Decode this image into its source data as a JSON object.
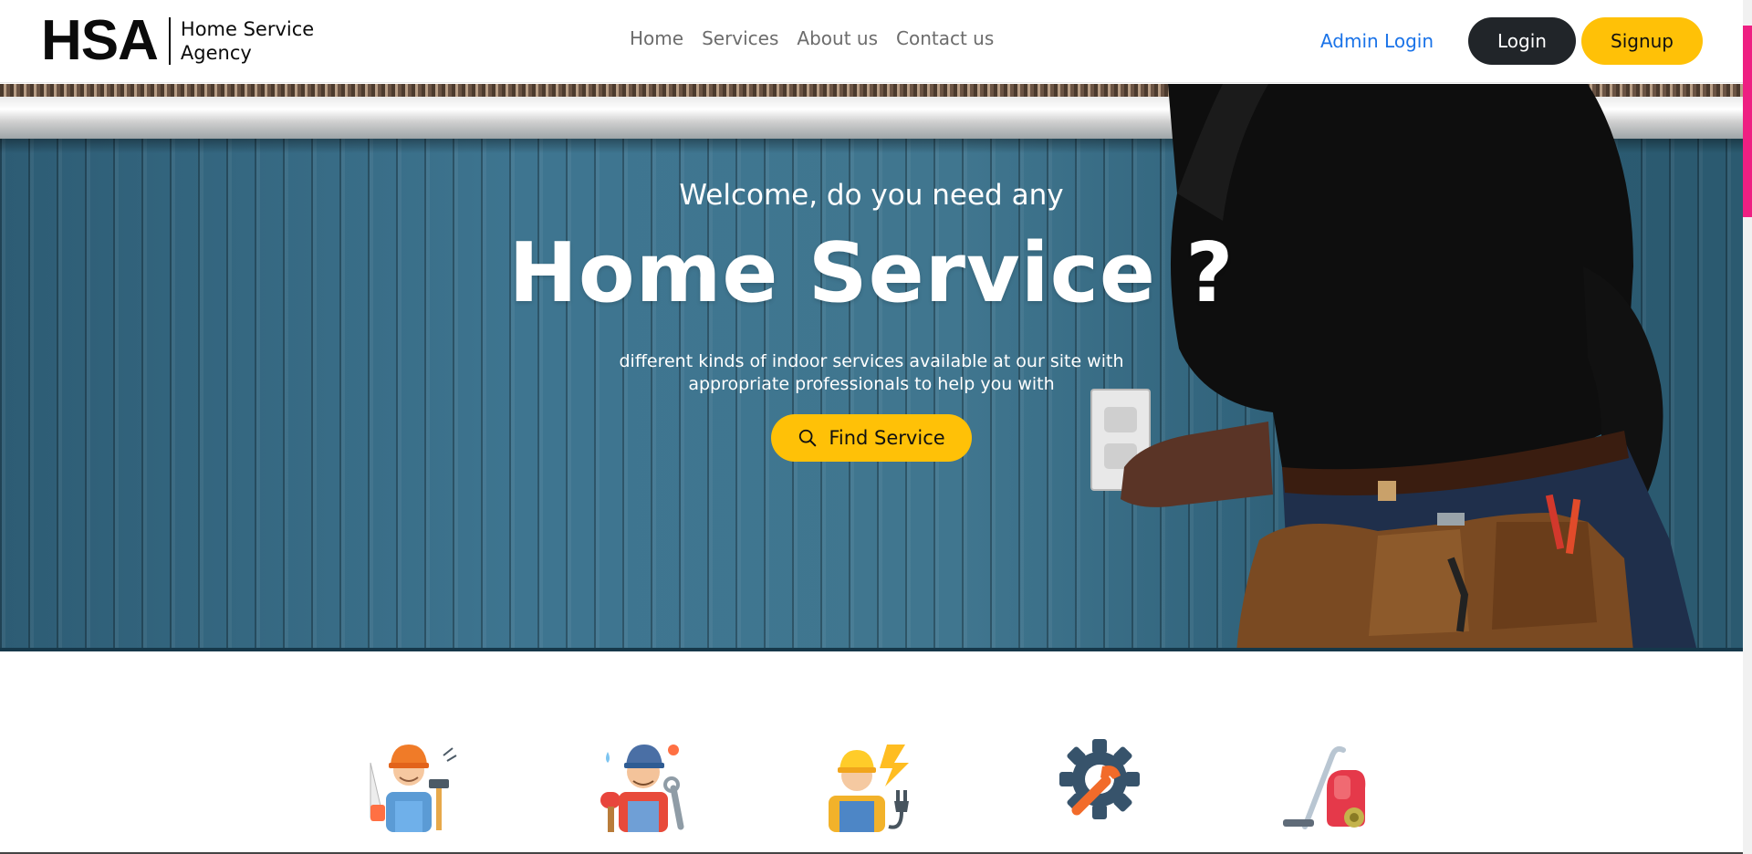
{
  "brand": {
    "mark": "HSA",
    "line1": "Home Service",
    "line2": "Agency"
  },
  "nav": {
    "links": [
      "Home",
      "Services",
      "About us",
      "Contact us"
    ],
    "admin_login": "Admin Login",
    "login": "Login",
    "signup": "Signup"
  },
  "hero": {
    "eyebrow": "Welcome, do you need any",
    "title": "Home Service ?",
    "description": "different kinds of indoor services available at our site with appropriate professionals to help you with",
    "cta": "Find Service"
  },
  "services": {
    "icons": [
      "carpenter-icon",
      "plumber-icon",
      "electrician-icon",
      "repair-gear-icon",
      "vacuum-cleaner-icon"
    ]
  },
  "colors": {
    "accent_yellow": "#ffc107",
    "dark_button": "#212529",
    "admin_link": "#1a73e8",
    "side_accent": "#ee1f82"
  }
}
